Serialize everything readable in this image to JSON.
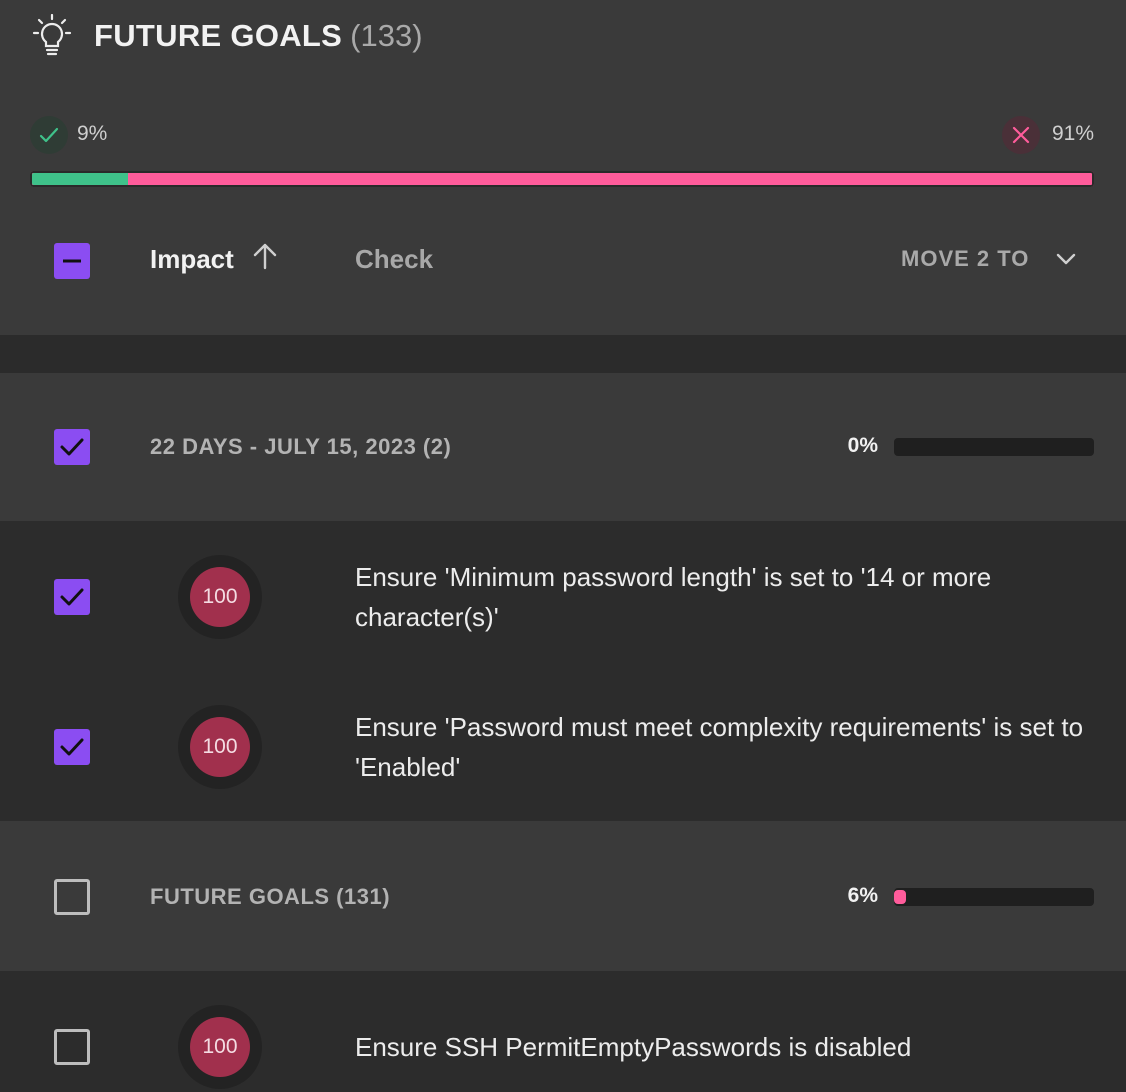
{
  "header": {
    "title": "FUTURE GOALS",
    "count": "(133)",
    "icon": "lightbulb-icon"
  },
  "summary": {
    "pass_pct": "9%",
    "fail_pct": "91%",
    "pass_fraction": 0.09,
    "colors": {
      "pass": "#3fc28a",
      "fail": "#ff5c9b",
      "accent": "#8b4df2",
      "impact": "#a1304d"
    }
  },
  "columns": {
    "impact": "Impact",
    "check": "Check",
    "move": "MOVE 2 TO"
  },
  "groups": [
    {
      "label": "22 DAYS - JULY 15, 2023 (2)",
      "pct": "0%",
      "fraction": 0.0,
      "checked": true,
      "items": [
        {
          "impact": "100",
          "text": "Ensure 'Minimum password length' is set to '14 or more character(s)'",
          "checked": true
        },
        {
          "impact": "100",
          "text": "Ensure 'Password must meet complexity requirements' is set to 'Enabled'",
          "checked": true
        }
      ]
    },
    {
      "label": "FUTURE GOALS (131)",
      "pct": "6%",
      "fraction": 0.06,
      "checked": false,
      "items": [
        {
          "impact": "100",
          "text": "Ensure SSH PermitEmptyPasswords is disabled",
          "checked": false
        }
      ]
    }
  ]
}
